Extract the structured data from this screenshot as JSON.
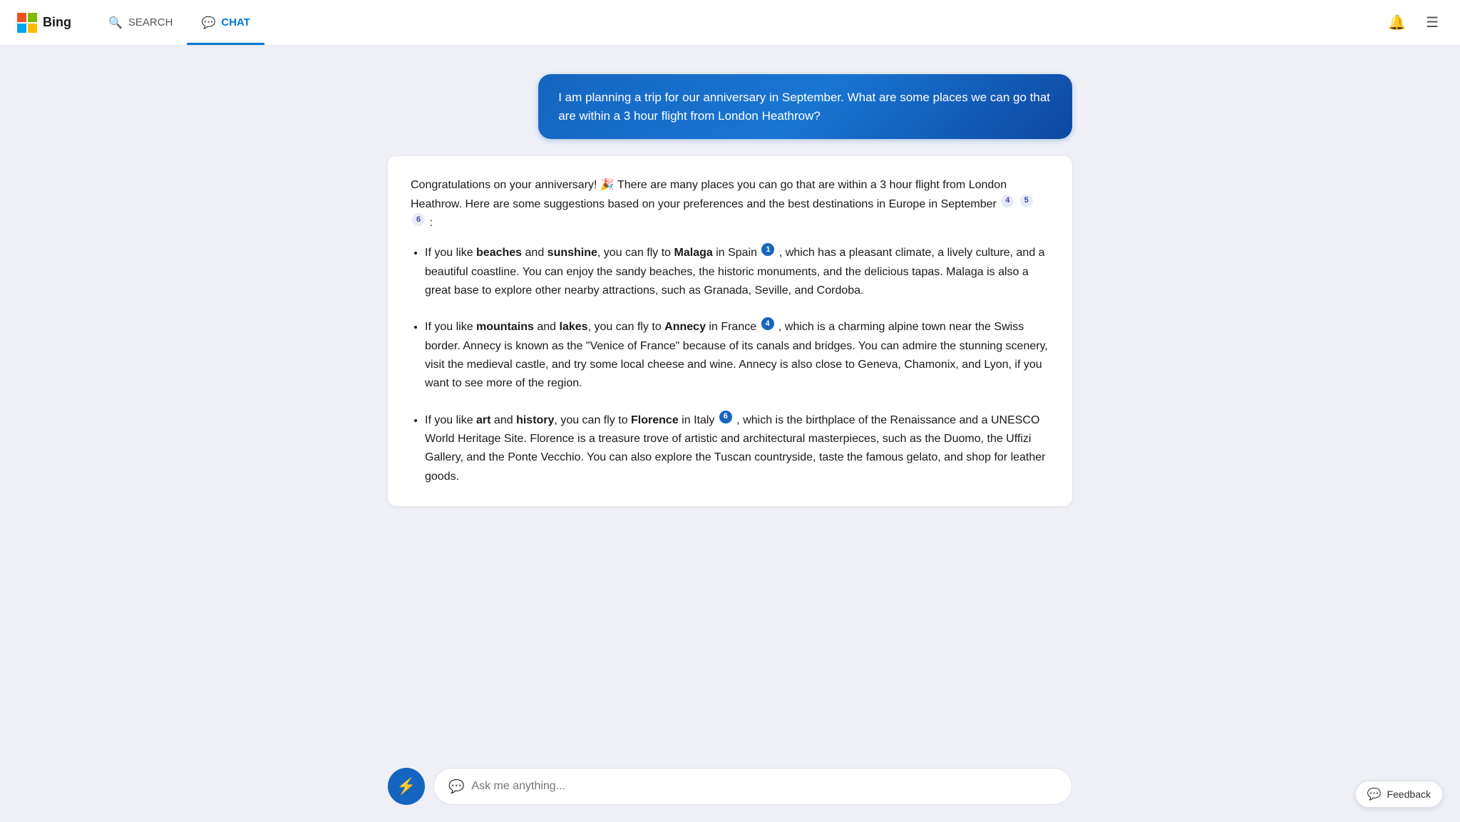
{
  "header": {
    "logo_text": "Bing",
    "tabs": [
      {
        "id": "search",
        "label": "SEARCH",
        "active": false
      },
      {
        "id": "chat",
        "label": "CHAT",
        "active": true
      }
    ]
  },
  "user_message": "I am planning a trip for our anniversary in September. What are some places we can go that are within a 3 hour flight from London Heathrow?",
  "ai_response": {
    "intro": "Congratulations on your anniversary! 🎉 There are many places you can go that are within a 3 hour flight from London Heathrow. Here are some suggestions based on your preferences and the best destinations in Europe in September",
    "intro_citations": [
      "4",
      "5",
      "6"
    ],
    "bullet_items": [
      {
        "id": 1,
        "text_parts": [
          "If you like ",
          "beaches",
          " and ",
          "sunshine",
          ", you can fly to ",
          "Malaga",
          " in Spain",
          " , which has a pleasant climate, a lively culture, and a beautiful coastline. You can enjoy the sandy beaches, the historic monuments, and the delicious tapas. Malaga is also a great base to explore other nearby attractions, such as Granada, Seville, and Cordoba."
        ],
        "bold": [
          "beaches",
          "sunshine",
          "Malaga"
        ],
        "citation": "1"
      },
      {
        "id": 2,
        "text_parts": [
          "If you like ",
          "mountains",
          " and ",
          "lakes",
          ", you can fly to ",
          "Annecy",
          " in France",
          " , which is a charming alpine town near the Swiss border. Annecy is known as the \"Venice of France\" because of its canals and bridges. You can admire the stunning scenery, visit the medieval castle, and try some local cheese and wine. Annecy is also close to Geneva, Chamonix, and Lyon, if you want to see more of the region."
        ],
        "bold": [
          "mountains",
          "lakes",
          "Annecy"
        ],
        "citation": "4"
      },
      {
        "id": 3,
        "text_parts": [
          "If you like ",
          "art",
          " and ",
          "history",
          ", you can fly to ",
          "Florence",
          " in Italy",
          " , which is the birthplace of the Renaissance and a UNESCO World Heritage Site. Florence is a treasure trove of artistic and architectural masterpieces, such as the Duomo, the Uffizi Gallery, and the Ponte Vecchio. You can also explore the Tuscan countryside, taste the famous gelato, and shop for leather goods."
        ],
        "bold": [
          "art",
          "history",
          "Florence"
        ],
        "citation": "6"
      }
    ]
  },
  "input": {
    "placeholder": "Ask me anything..."
  },
  "feedback_label": "Feedback"
}
